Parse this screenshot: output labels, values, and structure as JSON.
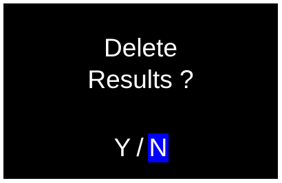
{
  "dialog": {
    "message_line1": "Delete",
    "message_line2": "Results ?",
    "options": {
      "yes_label": "Y",
      "separator": "/",
      "no_label": "N",
      "selected": "N"
    }
  },
  "colors": {
    "screen_background": "#000000",
    "text": "#ffffff",
    "selection_highlight": "#0000ff",
    "frame": "#ffffff"
  }
}
